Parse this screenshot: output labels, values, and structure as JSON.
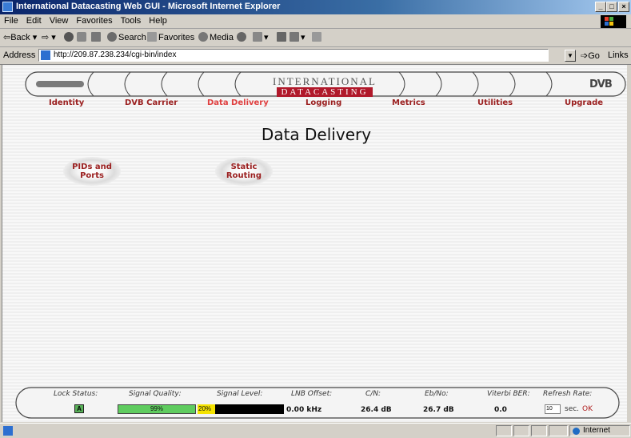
{
  "window": {
    "title": "International Datacasting Web GUI - Microsoft Internet Explorer"
  },
  "menu": [
    "File",
    "Edit",
    "View",
    "Favorites",
    "Tools",
    "Help"
  ],
  "toolbar": {
    "back": "Back",
    "search": "Search",
    "favorites": "Favorites",
    "media": "Media"
  },
  "address": {
    "label": "Address",
    "url": "http://209.87.238.234/cgi-bin/index",
    "go": "Go",
    "links": "Links"
  },
  "brand": {
    "line1": "INTERNATIONAL",
    "line2": "DATACASTING",
    "dvb": "DVB"
  },
  "nav": [
    {
      "label": "Identity"
    },
    {
      "label": "DVB Carrier"
    },
    {
      "label": "Data Delivery",
      "active": true
    },
    {
      "label": "Logging"
    },
    {
      "label": "Metrics"
    },
    {
      "label": "Utilities"
    },
    {
      "label": "Upgrade"
    }
  ],
  "page": {
    "title": "Data Delivery"
  },
  "actions": [
    {
      "line1": "PIDs and",
      "line2": "Ports"
    },
    {
      "line1": "Static",
      "line2": "Routing"
    }
  ],
  "status": {
    "lock_label": "Lock Status:",
    "lock_value": "A",
    "quality_label": "Signal Quality:",
    "quality_value": "99%",
    "quality_percent": 99,
    "level_label": "Signal Level:",
    "level_value": "20%",
    "level_percent": 20,
    "lnb_label": "LNB Offset:",
    "lnb_value": "0.00 kHz",
    "cn_label": "C/N:",
    "cn_value": "26.4 dB",
    "ebno_label": "Eb/No:",
    "ebno_value": "26.7 dB",
    "ber_label": "Viterbi BER:",
    "ber_value": "0.0",
    "refresh_label": "Refresh Rate:",
    "refresh_value": "10",
    "refresh_unit": "sec.",
    "refresh_ok": "OK"
  },
  "statusbar": {
    "zone": "Internet"
  }
}
